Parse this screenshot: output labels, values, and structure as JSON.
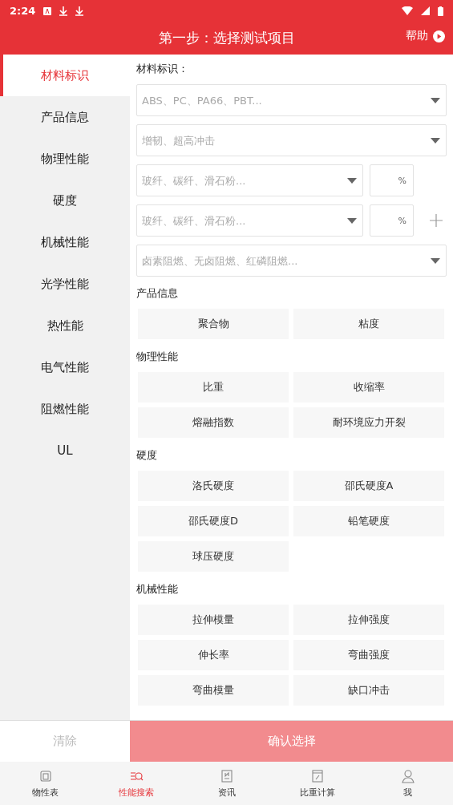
{
  "status_bar": {
    "time": "2:24"
  },
  "header": {
    "title": "第一步：选择测试项目",
    "help": "帮助"
  },
  "sidebar": {
    "items": [
      {
        "label": "材料标识",
        "selected": true
      },
      {
        "label": "产品信息",
        "selected": false
      },
      {
        "label": "物理性能",
        "selected": false
      },
      {
        "label": "硬度",
        "selected": false
      },
      {
        "label": "机械性能",
        "selected": false
      },
      {
        "label": "光学性能",
        "selected": false
      },
      {
        "label": "热性能",
        "selected": false
      },
      {
        "label": "电气性能",
        "selected": false
      },
      {
        "label": "阻燃性能",
        "selected": false
      },
      {
        "label": "UL",
        "selected": false
      }
    ]
  },
  "material": {
    "title": "材料标识：",
    "fields": [
      {
        "kind": "select",
        "placeholder": "ABS、PC、PA66、PBT..."
      },
      {
        "kind": "select",
        "placeholder": "增韧、超高冲击"
      },
      {
        "kind": "filler",
        "placeholder": "玻纤、碳纤、滑石粉...",
        "unit": "%"
      },
      {
        "kind": "filler_add",
        "placeholder": "玻纤、碳纤、滑石粉...",
        "unit": "%"
      },
      {
        "kind": "select",
        "placeholder": "卤素阻燃、无卤阻燃、红磷阻燃..."
      }
    ]
  },
  "sections": [
    {
      "title": "产品信息",
      "options": [
        "聚合物",
        "粘度"
      ]
    },
    {
      "title": "物理性能",
      "options": [
        "比重",
        "收缩率",
        "熔融指数",
        "耐环境应力开裂"
      ]
    },
    {
      "title": "硬度",
      "options": [
        "洛氏硬度",
        "邵氏硬度A",
        "邵氏硬度D",
        "铅笔硬度",
        "球压硬度"
      ]
    },
    {
      "title": "机械性能",
      "options": [
        "拉伸模量",
        "拉伸强度",
        "伸长率",
        "弯曲强度",
        "弯曲模量",
        "缺口冲击"
      ]
    }
  ],
  "actions": {
    "clear": "清除",
    "confirm": "确认选择"
  },
  "tab_bar": [
    {
      "label": "物性表",
      "selected": false
    },
    {
      "label": "性能搜索",
      "selected": true
    },
    {
      "label": "资讯",
      "selected": false
    },
    {
      "label": "比重计算",
      "selected": false
    },
    {
      "label": "我",
      "selected": false
    }
  ]
}
